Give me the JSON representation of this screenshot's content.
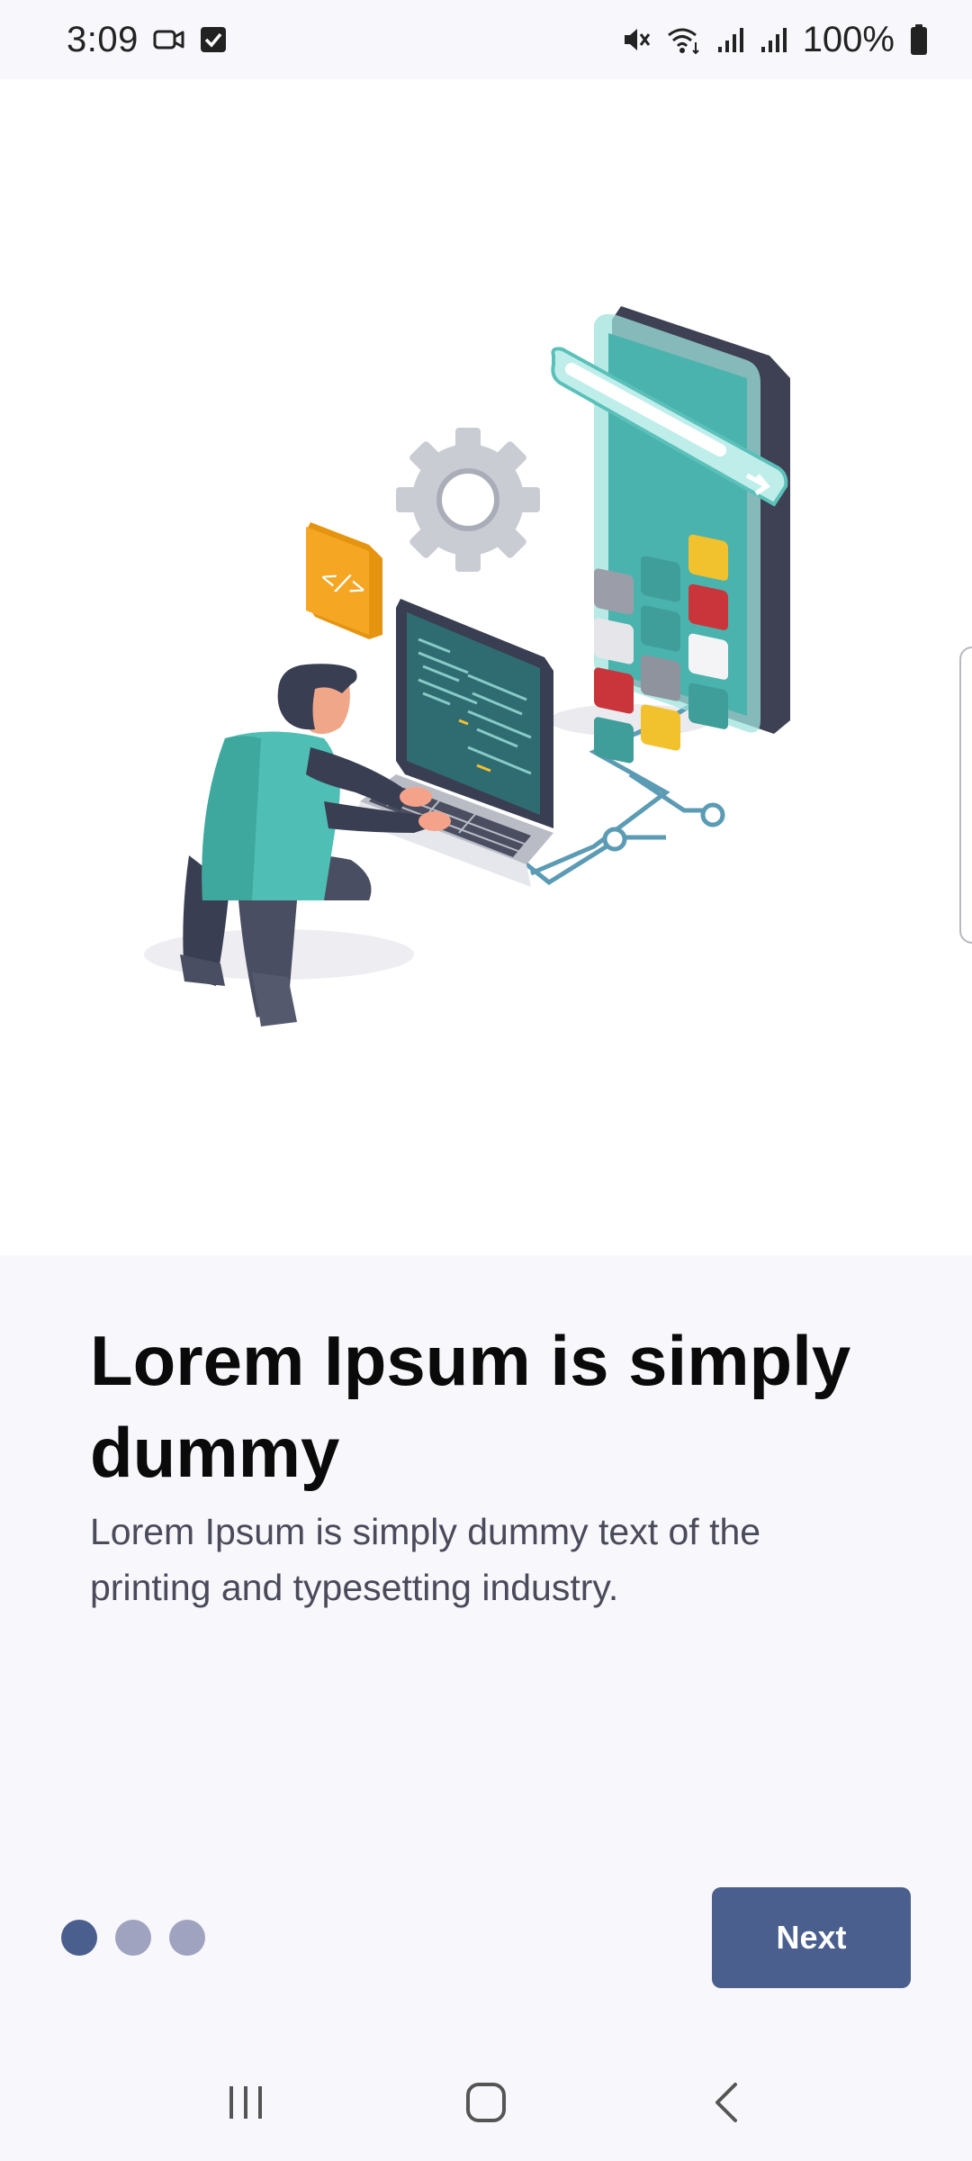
{
  "status_bar": {
    "time": "3:09",
    "battery_text": "100%",
    "icons": [
      "video-call-icon",
      "checkbox-notification-icon",
      "mute-icon",
      "wifi-icon",
      "signal-icon",
      "signal-icon-2",
      "battery-icon"
    ]
  },
  "onboarding": {
    "title": "Lorem Ipsum is simply dummy",
    "description": "Lorem Ipsum is simply dummy text of the printing and typesetting industry.",
    "page_indicator": {
      "current": 1,
      "total": 3
    },
    "next_label": "Next",
    "illustration": "developer-coding-illustration"
  },
  "nav_bar": {
    "buttons": [
      "recent-apps-icon",
      "home-icon",
      "back-icon"
    ]
  },
  "colors": {
    "accent": "#4a5f8e",
    "dot_inactive": "#9fa3bf",
    "background": "#f8f7fc",
    "title": "#0a0a0a",
    "description": "#4a4a5a"
  }
}
